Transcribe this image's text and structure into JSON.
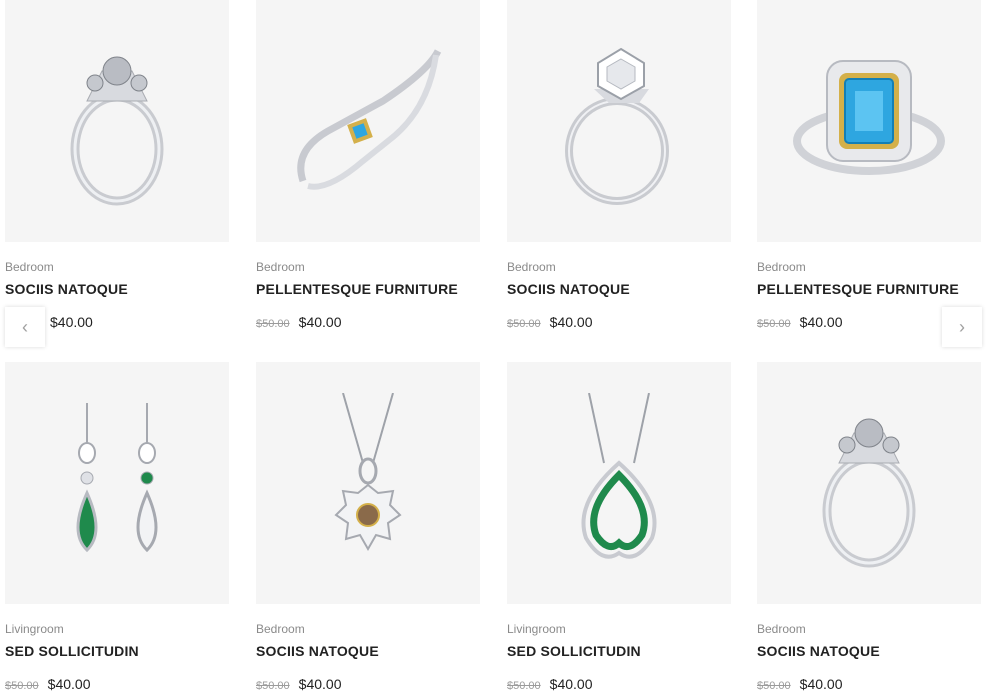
{
  "products": [
    {
      "category": "Bedroom",
      "title": "SOCIIS NATOQUE",
      "old_price": "",
      "price": "$40.00",
      "image": "ring-solitaire-icon"
    },
    {
      "category": "Bedroom",
      "title": "PELLENTESQUE FURNITURE",
      "old_price": "$50.00",
      "price": "$40.00",
      "image": "bracelet-icon"
    },
    {
      "category": "Bedroom",
      "title": "SOCIIS NATOQUE",
      "old_price": "$50.00",
      "price": "$40.00",
      "image": "ring-diamond-icon"
    },
    {
      "category": "Bedroom",
      "title": "PELLENTESQUE FURNITURE",
      "old_price": "$50.00",
      "price": "$40.00",
      "image": "ring-topaz-icon"
    },
    {
      "category": "Livingroom",
      "title": "SED SOLLICITUDIN",
      "old_price": "$50.00",
      "price": "$40.00",
      "image": "earrings-icon"
    },
    {
      "category": "Bedroom",
      "title": "SOCIIS NATOQUE",
      "old_price": "$50.00",
      "price": "$40.00",
      "image": "pendant-icon"
    },
    {
      "category": "Livingroom",
      "title": "SED SOLLICITUDIN",
      "old_price": "$50.00",
      "price": "$40.00",
      "image": "necklace-emerald-icon"
    },
    {
      "category": "Bedroom",
      "title": "SOCIIS NATOQUE",
      "old_price": "$50.00",
      "price": "$40.00",
      "image": "ring-solitaire-icon"
    }
  ],
  "nav": {
    "prev": "‹",
    "next": "›"
  },
  "colors": {
    "thumb_bg": "#f5f5f5",
    "text": "#222222",
    "muted": "#8a8a8a",
    "emerald": "#1f8a4c",
    "topaz": "#2ea6e0",
    "gold": "#d4b04a"
  }
}
